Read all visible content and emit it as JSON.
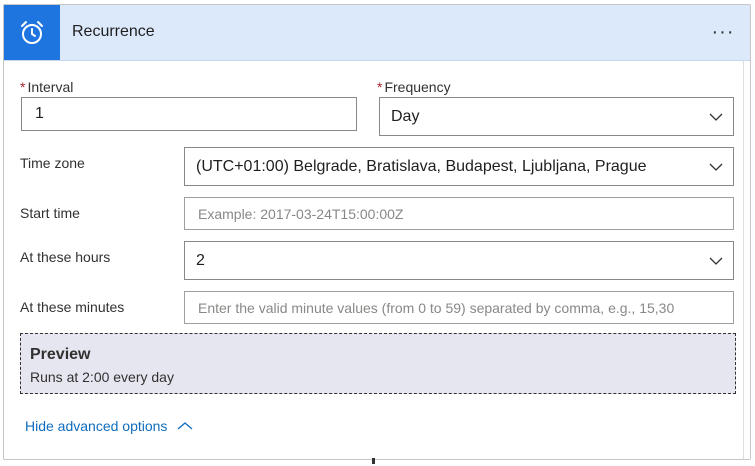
{
  "header": {
    "title": "Recurrence",
    "icon": "alarm-clock-icon",
    "more_label": "···",
    "accent": "#1f75e0",
    "bg": "#dbe9fb"
  },
  "interval": {
    "required_mark": "*",
    "label": "Interval",
    "value": "1"
  },
  "frequency": {
    "required_mark": "*",
    "label": "Frequency",
    "value": "Day"
  },
  "timezone": {
    "label": "Time zone",
    "value": "(UTC+01:00) Belgrade, Bratislava, Budapest, Ljubljana, Prague"
  },
  "start_time": {
    "label": "Start time",
    "placeholder": "Example: 2017-03-24T15:00:00Z"
  },
  "hours": {
    "label": "At these hours",
    "value": "2"
  },
  "minutes": {
    "label": "At these minutes",
    "placeholder": "Enter the valid minute values (from 0 to 59) separated by comma, e.g., 15,30"
  },
  "preview": {
    "title": "Preview",
    "text": "Runs at 2:00 every day"
  },
  "advanced": {
    "label": "Hide advanced options"
  }
}
